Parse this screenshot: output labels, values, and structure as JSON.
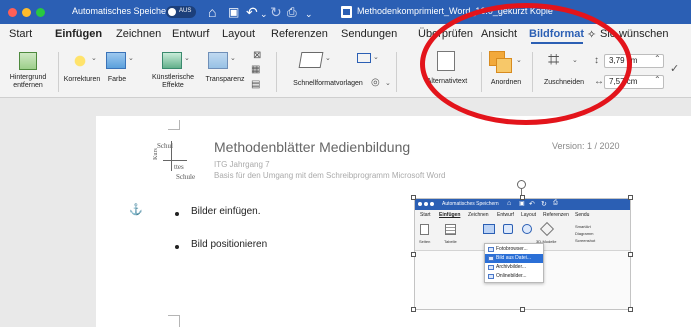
{
  "titlebar": {
    "autosave_label": "Automatisches Speichern",
    "autosave_toggle": "AUS",
    "document_title": "Methodenkomprimiert_Word_16.0_gekürzt Kopie",
    "colors": {
      "bar": "#2b5fb4",
      "close": "#ff5f57",
      "minimize": "#febc2e",
      "zoom": "#28c840"
    }
  },
  "tabs": [
    {
      "label": "Start"
    },
    {
      "label": "Einfügen"
    },
    {
      "label": "Zeichnen"
    },
    {
      "label": "Entwurf"
    },
    {
      "label": "Layout"
    },
    {
      "label": "Referenzen"
    },
    {
      "label": "Sendungen"
    },
    {
      "label": "Überprüfen"
    },
    {
      "label": "Ansicht"
    },
    {
      "label": "Bildformat",
      "active": true
    },
    {
      "label": "Sie wünschen"
    }
  ],
  "ribbon": {
    "hintergrund_entfernen": "Hintergrund\nentfernen",
    "korrekturen": "Korrekturen",
    "farbe": "Farbe",
    "kuenstlerische_effekte": "Künstlerische\nEffekte",
    "transparenz": "Transparenz",
    "schnellformatvorlagen": "Schnellformatvorlagen",
    "alternativtext": "Alternativtext",
    "anordnen": "Anordnen",
    "zuschneiden": "Zuschneiden",
    "height_value": "3,79 cm",
    "width_value": "7,57 cm"
  },
  "document": {
    "logo_line1": "Schul",
    "logo_line2": "Kurs",
    "logo_line3": "ttes",
    "logo_line4": "Schule",
    "heading": "Methodenblätter Medienbildung",
    "subline1": "ITG Jahrgang 7",
    "subline2": "Basis für den Umgang mit dem Schreibprogramm Microsoft Word",
    "version": "Version: 1 / 2020",
    "bullets": [
      "Bilder einfügen.",
      "Bild positionieren"
    ]
  },
  "embedded": {
    "title": "Automatisches Speichern",
    "tabs": [
      "Start",
      "Einfügen",
      "Zeichnen",
      "Entwurf",
      "Layout",
      "Referenzen",
      "Sendu"
    ],
    "ribbon_small": [
      "Seiten",
      "Tabelle",
      "3D-Modelle",
      "SmartArt",
      "Diagramm",
      "Screenshot"
    ],
    "menu_items": [
      "Fotobrowser...",
      "Bild aus Datei...",
      "Archivbilder...",
      "Onlinebilder..."
    ],
    "menu_selected_index": 1
  },
  "annotation": {
    "color": "#e3141b",
    "shape": "ellipse"
  }
}
